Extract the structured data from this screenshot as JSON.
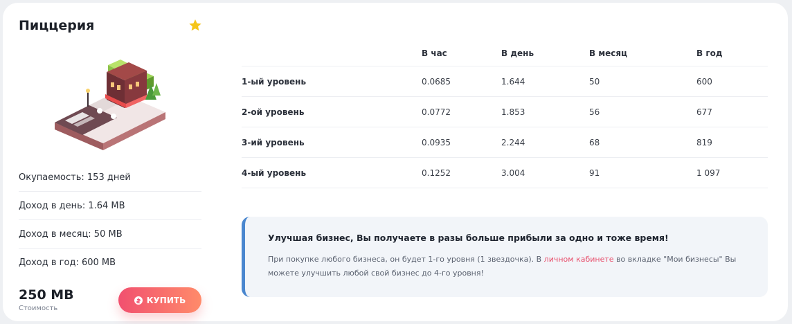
{
  "business": {
    "title": "Пиццерия",
    "favorite_icon": "star-icon",
    "favorite_color": "#f5c518",
    "illustration": "pizzeria-building-illustration"
  },
  "stats": [
    {
      "label": "Окупаемость: 153 дней"
    },
    {
      "label": "Доход в день: 1.64 MB"
    },
    {
      "label": "Доход в месяц: 50 MB"
    },
    {
      "label": "Доход в год: 600 MB"
    }
  ],
  "price": {
    "value": "250 MB",
    "label": "Стоимость"
  },
  "buy_button": {
    "label": "КУПИТЬ",
    "icon": "coin-icon",
    "gradient_from": "#f1506f",
    "gradient_to": "#ff8b6a"
  },
  "table": {
    "headers": [
      "",
      "В час",
      "В день",
      "В месяц",
      "В год"
    ],
    "rows": [
      {
        "level": "1-ый уровень",
        "hour": "0.0685",
        "day": "1.644",
        "month": "50",
        "year": "600"
      },
      {
        "level": "2-ой уровень",
        "hour": "0.0772",
        "day": "1.853",
        "month": "56",
        "year": "677"
      },
      {
        "level": "3-ий уровень",
        "hour": "0.0935",
        "day": "2.244",
        "month": "68",
        "year": "819"
      },
      {
        "level": "4-ый уровень",
        "hour": "0.1252",
        "day": "3.004",
        "month": "91",
        "year": "1 097"
      }
    ]
  },
  "info": {
    "title": "Улучшая бизнес, Вы получаете в разы больше прибыли за одно и тоже время!",
    "text_before": "При покупке любого бизнеса, он будет 1-го уровня (1 звездочка). В ",
    "link": "личном кабинете",
    "text_after": " во вкладке \"Мои бизнесы\" Вы можете улучшить любой свой бизнес до 4-го уровня!",
    "accent_color": "#4a87cf",
    "link_color": "#e8506d"
  }
}
